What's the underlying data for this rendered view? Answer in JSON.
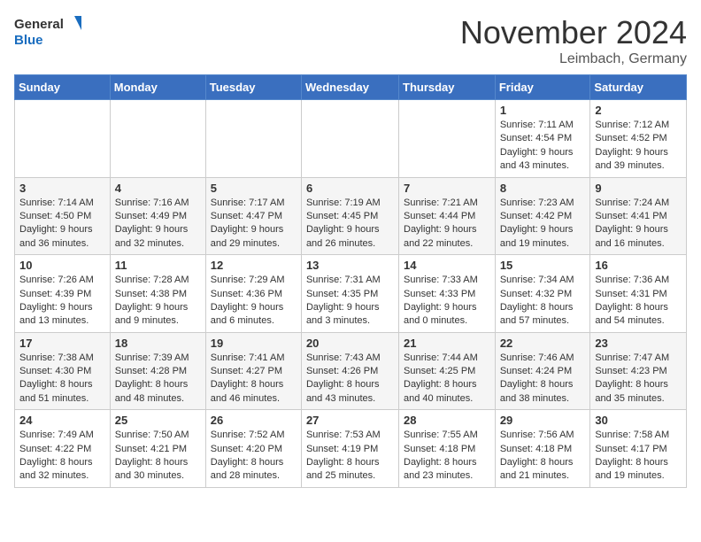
{
  "header": {
    "logo_general": "General",
    "logo_blue": "Blue",
    "month_title": "November 2024",
    "location": "Leimbach, Germany"
  },
  "weekdays": [
    "Sunday",
    "Monday",
    "Tuesday",
    "Wednesday",
    "Thursday",
    "Friday",
    "Saturday"
  ],
  "weeks": [
    [
      {
        "day": "",
        "sunrise": "",
        "sunset": "",
        "daylight": ""
      },
      {
        "day": "",
        "sunrise": "",
        "sunset": "",
        "daylight": ""
      },
      {
        "day": "",
        "sunrise": "",
        "sunset": "",
        "daylight": ""
      },
      {
        "day": "",
        "sunrise": "",
        "sunset": "",
        "daylight": ""
      },
      {
        "day": "",
        "sunrise": "",
        "sunset": "",
        "daylight": ""
      },
      {
        "day": "1",
        "sunrise": "Sunrise: 7:11 AM",
        "sunset": "Sunset: 4:54 PM",
        "daylight": "Daylight: 9 hours and 43 minutes."
      },
      {
        "day": "2",
        "sunrise": "Sunrise: 7:12 AM",
        "sunset": "Sunset: 4:52 PM",
        "daylight": "Daylight: 9 hours and 39 minutes."
      }
    ],
    [
      {
        "day": "3",
        "sunrise": "Sunrise: 7:14 AM",
        "sunset": "Sunset: 4:50 PM",
        "daylight": "Daylight: 9 hours and 36 minutes."
      },
      {
        "day": "4",
        "sunrise": "Sunrise: 7:16 AM",
        "sunset": "Sunset: 4:49 PM",
        "daylight": "Daylight: 9 hours and 32 minutes."
      },
      {
        "day": "5",
        "sunrise": "Sunrise: 7:17 AM",
        "sunset": "Sunset: 4:47 PM",
        "daylight": "Daylight: 9 hours and 29 minutes."
      },
      {
        "day": "6",
        "sunrise": "Sunrise: 7:19 AM",
        "sunset": "Sunset: 4:45 PM",
        "daylight": "Daylight: 9 hours and 26 minutes."
      },
      {
        "day": "7",
        "sunrise": "Sunrise: 7:21 AM",
        "sunset": "Sunset: 4:44 PM",
        "daylight": "Daylight: 9 hours and 22 minutes."
      },
      {
        "day": "8",
        "sunrise": "Sunrise: 7:23 AM",
        "sunset": "Sunset: 4:42 PM",
        "daylight": "Daylight: 9 hours and 19 minutes."
      },
      {
        "day": "9",
        "sunrise": "Sunrise: 7:24 AM",
        "sunset": "Sunset: 4:41 PM",
        "daylight": "Daylight: 9 hours and 16 minutes."
      }
    ],
    [
      {
        "day": "10",
        "sunrise": "Sunrise: 7:26 AM",
        "sunset": "Sunset: 4:39 PM",
        "daylight": "Daylight: 9 hours and 13 minutes."
      },
      {
        "day": "11",
        "sunrise": "Sunrise: 7:28 AM",
        "sunset": "Sunset: 4:38 PM",
        "daylight": "Daylight: 9 hours and 9 minutes."
      },
      {
        "day": "12",
        "sunrise": "Sunrise: 7:29 AM",
        "sunset": "Sunset: 4:36 PM",
        "daylight": "Daylight: 9 hours and 6 minutes."
      },
      {
        "day": "13",
        "sunrise": "Sunrise: 7:31 AM",
        "sunset": "Sunset: 4:35 PM",
        "daylight": "Daylight: 9 hours and 3 minutes."
      },
      {
        "day": "14",
        "sunrise": "Sunrise: 7:33 AM",
        "sunset": "Sunset: 4:33 PM",
        "daylight": "Daylight: 9 hours and 0 minutes."
      },
      {
        "day": "15",
        "sunrise": "Sunrise: 7:34 AM",
        "sunset": "Sunset: 4:32 PM",
        "daylight": "Daylight: 8 hours and 57 minutes."
      },
      {
        "day": "16",
        "sunrise": "Sunrise: 7:36 AM",
        "sunset": "Sunset: 4:31 PM",
        "daylight": "Daylight: 8 hours and 54 minutes."
      }
    ],
    [
      {
        "day": "17",
        "sunrise": "Sunrise: 7:38 AM",
        "sunset": "Sunset: 4:30 PM",
        "daylight": "Daylight: 8 hours and 51 minutes."
      },
      {
        "day": "18",
        "sunrise": "Sunrise: 7:39 AM",
        "sunset": "Sunset: 4:28 PM",
        "daylight": "Daylight: 8 hours and 48 minutes."
      },
      {
        "day": "19",
        "sunrise": "Sunrise: 7:41 AM",
        "sunset": "Sunset: 4:27 PM",
        "daylight": "Daylight: 8 hours and 46 minutes."
      },
      {
        "day": "20",
        "sunrise": "Sunrise: 7:43 AM",
        "sunset": "Sunset: 4:26 PM",
        "daylight": "Daylight: 8 hours and 43 minutes."
      },
      {
        "day": "21",
        "sunrise": "Sunrise: 7:44 AM",
        "sunset": "Sunset: 4:25 PM",
        "daylight": "Daylight: 8 hours and 40 minutes."
      },
      {
        "day": "22",
        "sunrise": "Sunrise: 7:46 AM",
        "sunset": "Sunset: 4:24 PM",
        "daylight": "Daylight: 8 hours and 38 minutes."
      },
      {
        "day": "23",
        "sunrise": "Sunrise: 7:47 AM",
        "sunset": "Sunset: 4:23 PM",
        "daylight": "Daylight: 8 hours and 35 minutes."
      }
    ],
    [
      {
        "day": "24",
        "sunrise": "Sunrise: 7:49 AM",
        "sunset": "Sunset: 4:22 PM",
        "daylight": "Daylight: 8 hours and 32 minutes."
      },
      {
        "day": "25",
        "sunrise": "Sunrise: 7:50 AM",
        "sunset": "Sunset: 4:21 PM",
        "daylight": "Daylight: 8 hours and 30 minutes."
      },
      {
        "day": "26",
        "sunrise": "Sunrise: 7:52 AM",
        "sunset": "Sunset: 4:20 PM",
        "daylight": "Daylight: 8 hours and 28 minutes."
      },
      {
        "day": "27",
        "sunrise": "Sunrise: 7:53 AM",
        "sunset": "Sunset: 4:19 PM",
        "daylight": "Daylight: 8 hours and 25 minutes."
      },
      {
        "day": "28",
        "sunrise": "Sunrise: 7:55 AM",
        "sunset": "Sunset: 4:18 PM",
        "daylight": "Daylight: 8 hours and 23 minutes."
      },
      {
        "day": "29",
        "sunrise": "Sunrise: 7:56 AM",
        "sunset": "Sunset: 4:18 PM",
        "daylight": "Daylight: 8 hours and 21 minutes."
      },
      {
        "day": "30",
        "sunrise": "Sunrise: 7:58 AM",
        "sunset": "Sunset: 4:17 PM",
        "daylight": "Daylight: 8 hours and 19 minutes."
      }
    ]
  ]
}
